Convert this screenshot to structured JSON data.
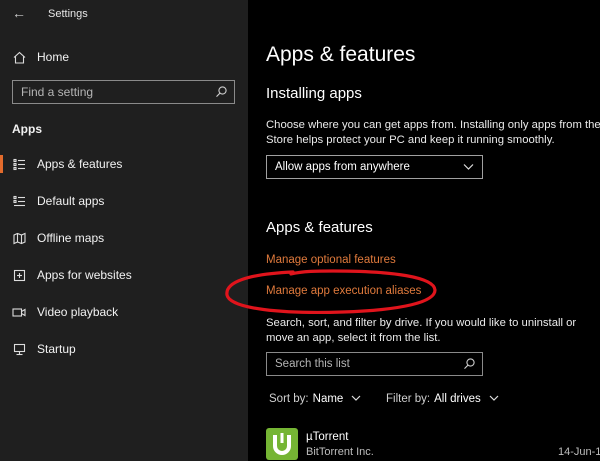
{
  "window": {
    "title": "Settings",
    "back_glyph": "←"
  },
  "sidebar": {
    "home_label": "Home",
    "search_placeholder": "Find a setting",
    "section_label": "Apps",
    "items": [
      {
        "label": "Apps & features",
        "icon": "apps-features-icon",
        "selected": true
      },
      {
        "label": "Default apps",
        "icon": "default-apps-icon"
      },
      {
        "label": "Offline maps",
        "icon": "offline-maps-icon"
      },
      {
        "label": "Apps for websites",
        "icon": "apps-for-websites-icon"
      },
      {
        "label": "Video playback",
        "icon": "video-playback-icon"
      },
      {
        "label": "Startup",
        "icon": "startup-icon"
      }
    ]
  },
  "main": {
    "page_title": "Apps & features",
    "installing_heading": "Installing apps",
    "installing_desc_line1": "Choose where you can get apps from. Installing only apps from the",
    "installing_desc_line2": "Store helps protect your PC and keep it running smoothly.",
    "install_source_value": "Allow apps from anywhere",
    "features_heading": "Apps & features",
    "link_optional_features": "Manage optional features",
    "link_execution_aliases": "Manage app execution aliases",
    "list_desc_line1": "Search, sort, and filter by drive. If you would like to uninstall or",
    "list_desc_line2": "move an app, select it from the list.",
    "search_placeholder": "Search this list",
    "sort_label": "Sort by:",
    "sort_value": "Name",
    "filter_label": "Filter by:",
    "filter_value": "All drives",
    "apps": [
      {
        "name": "µTorrent",
        "publisher": "BitTorrent Inc.",
        "date": "14-Jun-1"
      }
    ]
  },
  "colors": {
    "accent": "#e36b2c",
    "link": "#e07a3c",
    "annotation": "#e0141c"
  }
}
